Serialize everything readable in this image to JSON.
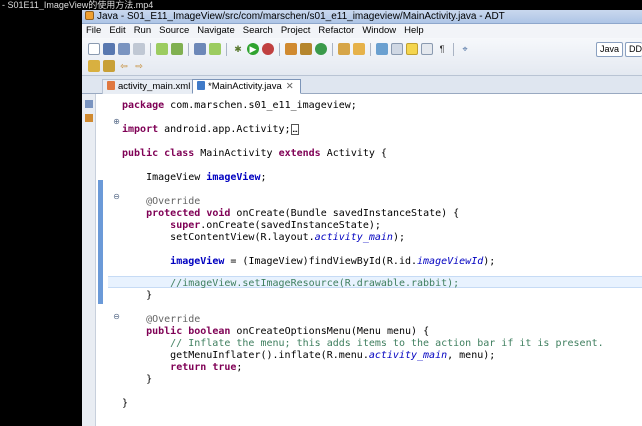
{
  "player": {
    "title": "- S01E11_ImageView的使用方法.mp4"
  },
  "window": {
    "title": "Java - S01_E11_ImageView/src/com/marschen/s01_e11_imageview/MainActivity.java - ADT"
  },
  "menu": [
    "File",
    "Edit",
    "Run",
    "Source",
    "Navigate",
    "Search",
    "Project",
    "Refactor",
    "Window",
    "Help"
  ],
  "perspectives": {
    "java": "Java",
    "ddms": "DDMS"
  },
  "tabs": [
    {
      "label": "activity_main.xml",
      "active": false
    },
    {
      "label": "*MainActivity.java",
      "active": true,
      "close": "✕"
    }
  ],
  "code": {
    "l1a": "package",
    "l1b": " com.marschen.s01_e11_imageview;",
    "l2a": "import",
    "l2b": " android.app.Activity;",
    "l2c": "…",
    "l3a": "public",
    "l3b": " ",
    "l3c": "class",
    "l3d": " MainActivity ",
    "l3e": "extends",
    "l3f": " Activity {",
    "l4a": "    ImageView ",
    "l4b": "imageView",
    "l4c": ";",
    "l5": "    @Override",
    "l6a": "    ",
    "l6b": "protected",
    "l6c": " ",
    "l6d": "void",
    "l6e": " onCreate(Bundle savedInstanceState) {",
    "l7a": "        ",
    "l7b": "super",
    "l7c": ".onCreate(savedInstanceState);",
    "l8a": "        setContentView(R.layout.",
    "l8b": "activity_main",
    "l8c": ");",
    "l9a": "        ",
    "l9b": "imageView",
    "l9c": " = (ImageView)findViewById(R.id.",
    "l9d": "imageViewId",
    "l9e": ");",
    "l10": "        //imageView.setImageResource(R.drawable.rabbit);",
    "l11": "    }",
    "l12": "    @Override",
    "l13a": "    ",
    "l13b": "public",
    "l13c": " ",
    "l13d": "boolean",
    "l13e": " onCreateOptionsMenu(Menu menu) {",
    "l14": "        // Inflate the menu; this adds items to the action bar if it is present.",
    "l15a": "        getMenuInflater().inflate(R.menu.",
    "l15b": "activity_main",
    "l15c": ", menu);",
    "l16a": "        ",
    "l16b": "return",
    "l16c": " ",
    "l16d": "true",
    "l16e": ";",
    "l17": "    }",
    "l18": "}"
  },
  "colors": {
    "keyword": "#7f0055",
    "field": "#0000c0",
    "comment": "#3f7f5f",
    "annotation": "#646464"
  }
}
